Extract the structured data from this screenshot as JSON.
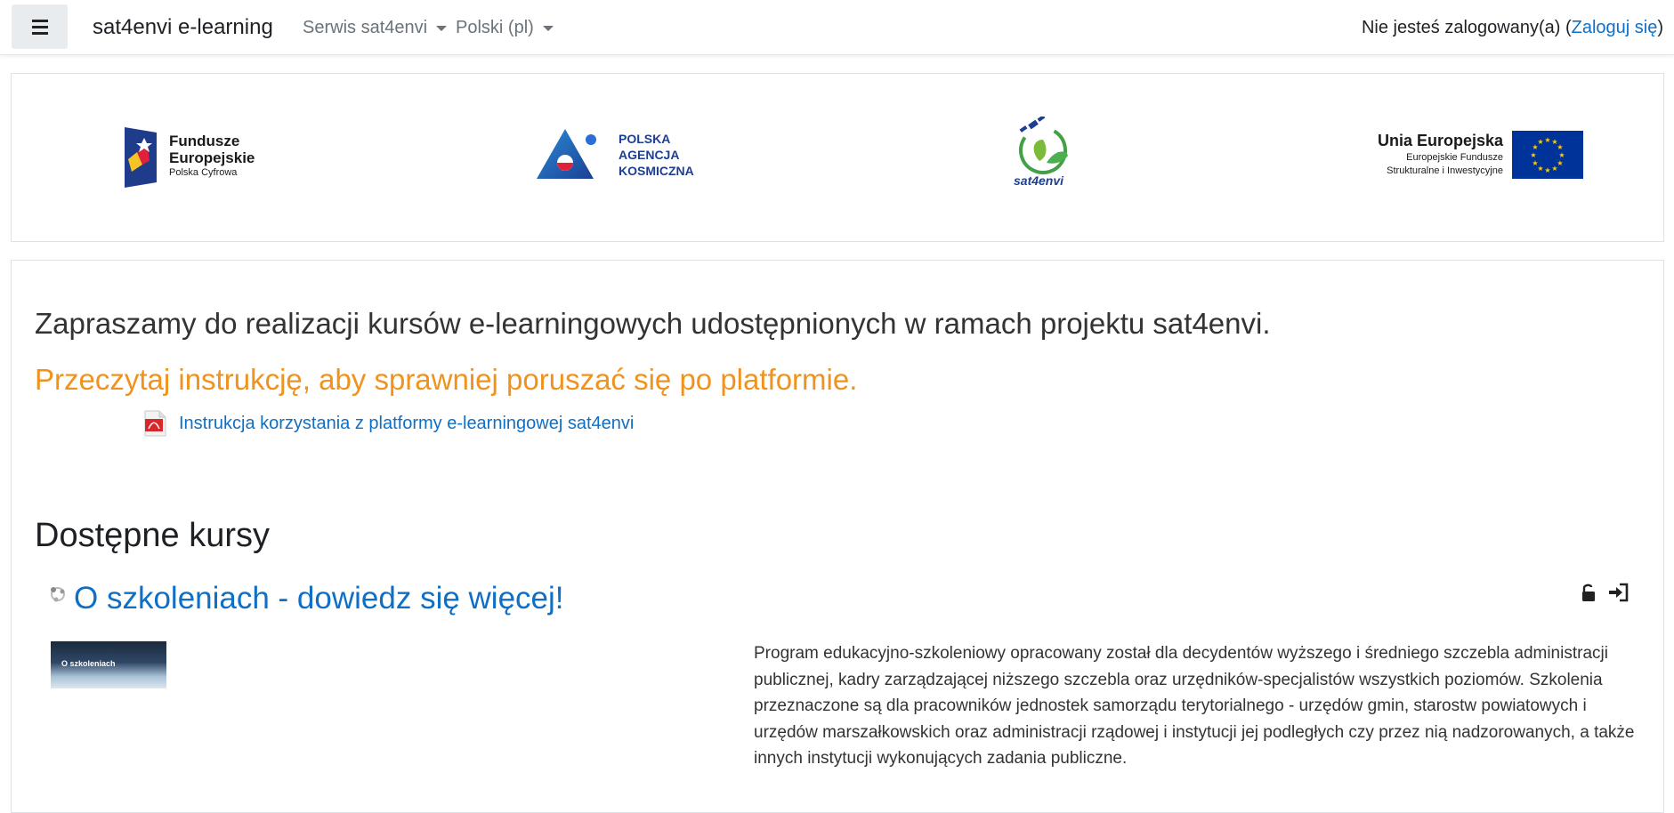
{
  "navbar": {
    "brand": "sat4envi e-learning",
    "menu_service": "Serwis sat4envi",
    "menu_language": "Polski (pl)",
    "login_prefix": "Nie jesteś zalogowany(a) (",
    "login_link": "Zaloguj się",
    "login_suffix": ")"
  },
  "logos": {
    "fe_line1": "Fundusze",
    "fe_line2": "Europejskie",
    "fe_line3": "Polska Cyfrowa",
    "pak_line1": "POLSKA",
    "pak_line2": "AGENCJA",
    "pak_line3": "KOSMICZNA",
    "sat_text": "sat4envi",
    "ue_line1": "Unia Europejska",
    "ue_line2": "Europejskie Fundusze",
    "ue_line3": "Strukturalne i Inwestycyjne"
  },
  "main": {
    "intro": "Zapraszamy do realizacji kursów e-learningowych udostępnionych w ramach projektu sat4envi.",
    "intro_highlight": "Przeczytaj instrukcję, aby sprawniej poruszać się po platformie.",
    "pdf_link": "Instrukcja korzystania z platformy e-learningowej sat4envi",
    "section_title": "Dostępne kursy"
  },
  "course": {
    "title": "O szkoleniach - dowiedz się więcej!",
    "thumb_text": "O szkoleniach",
    "description": "Program edukacyjno-szkoleniowy opracowany został dla decydentów wyższego i średniego szczebla administracji publicznej, kadry zarządzającej niższego szczebla oraz urzędników-specjalistów wszystkich poziomów. Szkolenia przeznaczone są dla pracowników jednostek samorządu terytorialnego - urzędów gmin, starostw powiatowych i urzędów marszałkowskich oraz administracji rządowej i instytucji jej podległych czy przez nią nadzorowanych, a także innych instytucji wykonujących zadania publiczne."
  },
  "colors": {
    "link": "#0f6fc5",
    "highlight": "#f0931e",
    "eu_blue": "#003399",
    "eu_yellow": "#ffcc00"
  }
}
